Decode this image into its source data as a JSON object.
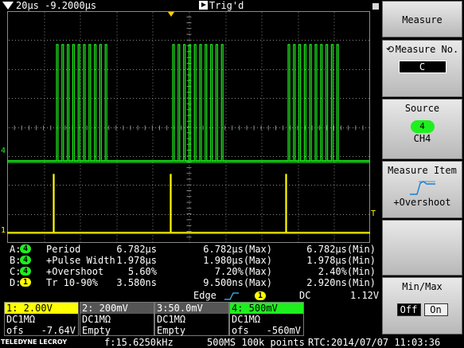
{
  "topbar": {
    "timebase": "20µs  -9.2000µs",
    "trig_status": "Trig'd"
  },
  "channel_markers": {
    "ch4": "4",
    "ch1": "1",
    "trigger": "T"
  },
  "measurements": [
    {
      "letter": "A:",
      "ch": "4",
      "name": "Period",
      "value": "6.782µs",
      "max": "6.782µs(Max)",
      "min": "6.782µs(Min)",
      "color": "#1ef01e"
    },
    {
      "letter": "B:",
      "ch": "4",
      "name": "+Pulse Width",
      "value": "1.978µs",
      "max": "1.980µs(Max)",
      "min": "1.978µs(Min)",
      "color": "#1ef01e"
    },
    {
      "letter": "C:",
      "ch": "4",
      "name": "+Overshoot",
      "value": "5.60%",
      "max": "7.20%(Max)",
      "min": "2.40%(Min)",
      "color": "#1ef01e"
    },
    {
      "letter": "D:",
      "ch": "1",
      "name": "Tr 10-90%",
      "value": "3.580ns",
      "max": "9.500ns(Max)",
      "min": "2.920ns(Min)",
      "color": "#ffff00"
    }
  ],
  "trigger": {
    "type": "Edge",
    "source": "1",
    "coupling": "DC",
    "level": "1.12V"
  },
  "channels": [
    {
      "header": "1: 2.00V",
      "coupling": "DC1MΩ",
      "ofs_label": "ofs",
      "ofs": "-7.64V"
    },
    {
      "header": "2: 200mV",
      "coupling": "DC1MΩ",
      "line2": "Empty"
    },
    {
      "header": "3:50.0mV",
      "coupling": "DC1MΩ",
      "line2": "Empty"
    },
    {
      "header": "4: 500mV",
      "coupling": "DC1MΩ",
      "ofs_label": "ofs",
      "ofs": "-560mV"
    }
  ],
  "bottombar": {
    "brand": "TELEDYNE LECROY",
    "freq": "f:15.6250kHz",
    "acq": "500MS 100k points",
    "rtc": "RTC:2014/07/07 11:03:36"
  },
  "menu": {
    "measure": "Measure",
    "measure_no_title": "Measure No.",
    "measure_no_value": "C",
    "source_title": "Source",
    "source_badge": "4",
    "source_label": "CH4",
    "item_title": "Measure Item",
    "item_label": "+Overshoot",
    "minmax_title": "Min/Max",
    "off": "Off",
    "on": "On",
    "knob_icon": "⟲"
  },
  "colors": {
    "ch1": "#ffff00",
    "ch4": "#1ef01e",
    "grid": "#8a8a8a"
  },
  "icons": {
    "run": "play-icon",
    "edge": "rising-edge-icon",
    "knob": "adjust-knob-icon"
  }
}
